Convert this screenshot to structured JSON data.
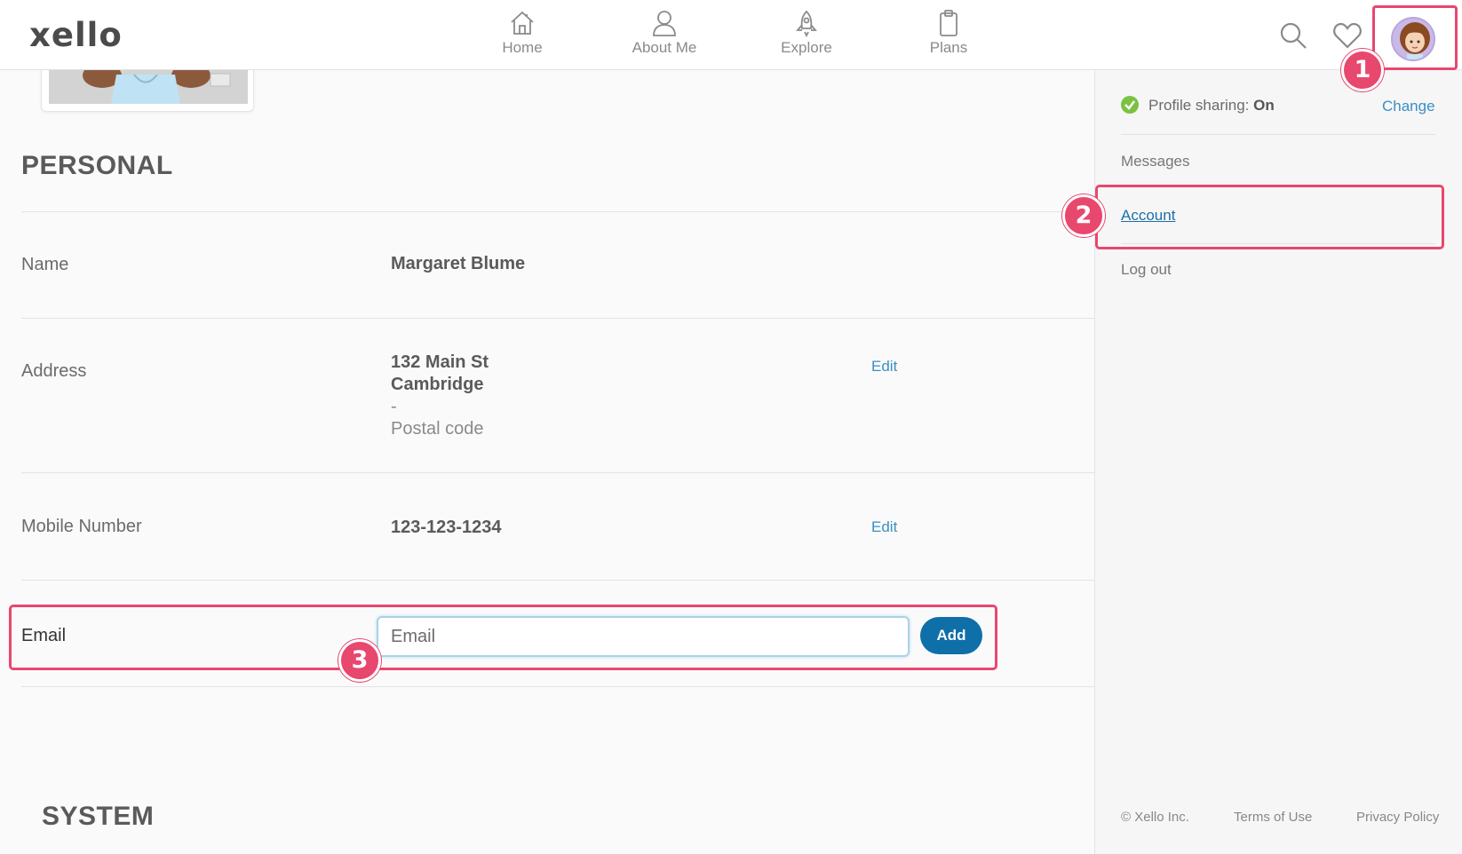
{
  "app": {
    "logo": "xello"
  },
  "nav": {
    "items": [
      {
        "label": "Home",
        "icon": "home-icon"
      },
      {
        "label": "About Me",
        "icon": "person-icon"
      },
      {
        "label": "Explore",
        "icon": "rocket-icon"
      },
      {
        "label": "Plans",
        "icon": "clipboard-icon"
      }
    ]
  },
  "header_icons": [
    "search-icon",
    "heart-icon",
    "avatar"
  ],
  "personal": {
    "title": "PERSONAL",
    "name_label": "Name",
    "name_value": "Margaret Blume",
    "address_label": "Address",
    "address_line1": "132 Main St",
    "address_line2": "Cambridge",
    "address_line3": "-",
    "address_postal": "Postal code",
    "address_edit": "Edit",
    "mobile_label": "Mobile Number",
    "mobile_value": "123-123-1234",
    "mobile_edit": "Edit",
    "email_label": "Email",
    "email_placeholder": "Email",
    "email_value": "",
    "add_label": "Add"
  },
  "system": {
    "title": "SYSTEM"
  },
  "panel": {
    "sharing_label": "Profile sharing:",
    "sharing_value": "On",
    "change_label": "Change",
    "messages": "Messages",
    "account": "Account",
    "logout": "Log out",
    "footer": {
      "copyright": "© Xello Inc.",
      "terms": "Terms of Use",
      "privacy": "Privacy Policy"
    }
  },
  "badges": {
    "step1": "1",
    "step2": "2",
    "step3": "3"
  },
  "colors": {
    "highlight": "#e8476e",
    "primary_button": "#0f6fa8",
    "link": "#3a8fc4",
    "success": "#7cc242"
  }
}
